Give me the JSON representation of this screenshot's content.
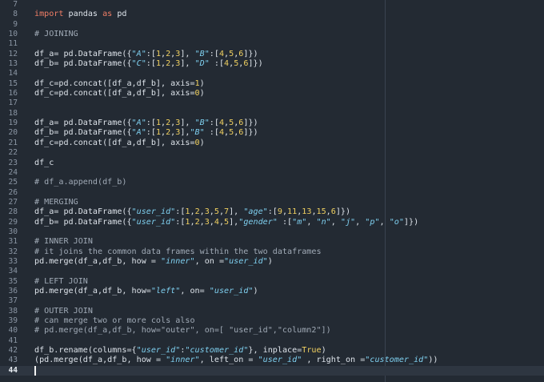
{
  "editor": {
    "current_line": 44,
    "lines": [
      {
        "n": 7,
        "tokens": []
      },
      {
        "n": 8,
        "tokens": [
          {
            "t": "kw",
            "v": "import"
          },
          {
            "t": "id",
            "v": " pandas "
          },
          {
            "t": "kw",
            "v": "as"
          },
          {
            "t": "id",
            "v": " pd"
          }
        ]
      },
      {
        "n": 9,
        "tokens": []
      },
      {
        "n": 10,
        "tokens": [
          {
            "t": "cm",
            "v": "# JOINING"
          }
        ]
      },
      {
        "n": 11,
        "tokens": []
      },
      {
        "n": 12,
        "tokens": [
          {
            "t": "id",
            "v": "df_a"
          },
          {
            "t": "op",
            "v": "= "
          },
          {
            "t": "id",
            "v": "pd.DataFrame({"
          },
          {
            "t": "str",
            "v": "\"A\""
          },
          {
            "t": "op",
            "v": ":["
          },
          {
            "t": "num",
            "v": "1"
          },
          {
            "t": "op",
            "v": ","
          },
          {
            "t": "num",
            "v": "2"
          },
          {
            "t": "op",
            "v": ","
          },
          {
            "t": "num",
            "v": "3"
          },
          {
            "t": "op",
            "v": "], "
          },
          {
            "t": "str",
            "v": "\"B\""
          },
          {
            "t": "op",
            "v": ":["
          },
          {
            "t": "num",
            "v": "4"
          },
          {
            "t": "op",
            "v": ","
          },
          {
            "t": "num",
            "v": "5"
          },
          {
            "t": "op",
            "v": ","
          },
          {
            "t": "num",
            "v": "6"
          },
          {
            "t": "op",
            "v": "]})"
          }
        ]
      },
      {
        "n": 13,
        "tokens": [
          {
            "t": "id",
            "v": "df_b"
          },
          {
            "t": "op",
            "v": "= "
          },
          {
            "t": "id",
            "v": "pd.DataFrame({"
          },
          {
            "t": "str",
            "v": "\"C\""
          },
          {
            "t": "op",
            "v": ":["
          },
          {
            "t": "num",
            "v": "1"
          },
          {
            "t": "op",
            "v": ","
          },
          {
            "t": "num",
            "v": "2"
          },
          {
            "t": "op",
            "v": ","
          },
          {
            "t": "num",
            "v": "3"
          },
          {
            "t": "op",
            "v": "], "
          },
          {
            "t": "str",
            "v": "\"D\""
          },
          {
            "t": "op",
            "v": " :["
          },
          {
            "t": "num",
            "v": "4"
          },
          {
            "t": "op",
            "v": ","
          },
          {
            "t": "num",
            "v": "5"
          },
          {
            "t": "op",
            "v": ","
          },
          {
            "t": "num",
            "v": "6"
          },
          {
            "t": "op",
            "v": "]})"
          }
        ]
      },
      {
        "n": 14,
        "tokens": []
      },
      {
        "n": 15,
        "tokens": [
          {
            "t": "id",
            "v": "df_c"
          },
          {
            "t": "op",
            "v": "="
          },
          {
            "t": "id",
            "v": "pd.concat([df_a,df_b], axis"
          },
          {
            "t": "op",
            "v": "="
          },
          {
            "t": "num",
            "v": "1"
          },
          {
            "t": "op",
            "v": ")"
          }
        ]
      },
      {
        "n": 16,
        "tokens": [
          {
            "t": "id",
            "v": "df_c"
          },
          {
            "t": "op",
            "v": "="
          },
          {
            "t": "id",
            "v": "pd.concat([df_a,df_b], axis"
          },
          {
            "t": "op",
            "v": "="
          },
          {
            "t": "num",
            "v": "0"
          },
          {
            "t": "op",
            "v": ")"
          }
        ]
      },
      {
        "n": 17,
        "tokens": []
      },
      {
        "n": 18,
        "tokens": []
      },
      {
        "n": 19,
        "tokens": [
          {
            "t": "id",
            "v": "df_a"
          },
          {
            "t": "op",
            "v": "= "
          },
          {
            "t": "id",
            "v": "pd.DataFrame({"
          },
          {
            "t": "str",
            "v": "\"A\""
          },
          {
            "t": "op",
            "v": ":["
          },
          {
            "t": "num",
            "v": "1"
          },
          {
            "t": "op",
            "v": ","
          },
          {
            "t": "num",
            "v": "2"
          },
          {
            "t": "op",
            "v": ","
          },
          {
            "t": "num",
            "v": "3"
          },
          {
            "t": "op",
            "v": "], "
          },
          {
            "t": "str",
            "v": "\"B\""
          },
          {
            "t": "op",
            "v": ":["
          },
          {
            "t": "num",
            "v": "4"
          },
          {
            "t": "op",
            "v": ","
          },
          {
            "t": "num",
            "v": "5"
          },
          {
            "t": "op",
            "v": ","
          },
          {
            "t": "num",
            "v": "6"
          },
          {
            "t": "op",
            "v": "]})"
          }
        ]
      },
      {
        "n": 20,
        "tokens": [
          {
            "t": "id",
            "v": "df_b"
          },
          {
            "t": "op",
            "v": "= "
          },
          {
            "t": "id",
            "v": "pd.DataFrame({"
          },
          {
            "t": "str",
            "v": "\"A\""
          },
          {
            "t": "op",
            "v": ":["
          },
          {
            "t": "num",
            "v": "1"
          },
          {
            "t": "op",
            "v": ","
          },
          {
            "t": "num",
            "v": "2"
          },
          {
            "t": "op",
            "v": ","
          },
          {
            "t": "num",
            "v": "3"
          },
          {
            "t": "op",
            "v": "],"
          },
          {
            "t": "str",
            "v": "\"B\""
          },
          {
            "t": "op",
            "v": " :["
          },
          {
            "t": "num",
            "v": "4"
          },
          {
            "t": "op",
            "v": ","
          },
          {
            "t": "num",
            "v": "5"
          },
          {
            "t": "op",
            "v": ","
          },
          {
            "t": "num",
            "v": "6"
          },
          {
            "t": "op",
            "v": "]})"
          }
        ]
      },
      {
        "n": 21,
        "tokens": [
          {
            "t": "id",
            "v": "df_c"
          },
          {
            "t": "op",
            "v": "="
          },
          {
            "t": "id",
            "v": "pd.concat([df_a,df_b], axis"
          },
          {
            "t": "op",
            "v": "="
          },
          {
            "t": "num",
            "v": "0"
          },
          {
            "t": "op",
            "v": ")"
          }
        ]
      },
      {
        "n": 22,
        "tokens": []
      },
      {
        "n": 23,
        "tokens": [
          {
            "t": "id",
            "v": "df_c"
          }
        ]
      },
      {
        "n": 24,
        "tokens": []
      },
      {
        "n": 25,
        "tokens": [
          {
            "t": "cm",
            "v": "# df_a.append(df_b)"
          }
        ]
      },
      {
        "n": 26,
        "tokens": []
      },
      {
        "n": 27,
        "tokens": [
          {
            "t": "cm",
            "v": "# MERGING"
          }
        ]
      },
      {
        "n": 28,
        "tokens": [
          {
            "t": "id",
            "v": "df_a"
          },
          {
            "t": "op",
            "v": "= "
          },
          {
            "t": "id",
            "v": "pd.DataFrame({"
          },
          {
            "t": "str",
            "v": "\"user_id\""
          },
          {
            "t": "op",
            "v": ":["
          },
          {
            "t": "num",
            "v": "1"
          },
          {
            "t": "op",
            "v": ","
          },
          {
            "t": "num",
            "v": "2"
          },
          {
            "t": "op",
            "v": ","
          },
          {
            "t": "num",
            "v": "3"
          },
          {
            "t": "op",
            "v": ","
          },
          {
            "t": "num",
            "v": "5"
          },
          {
            "t": "op",
            "v": ","
          },
          {
            "t": "num",
            "v": "7"
          },
          {
            "t": "op",
            "v": "], "
          },
          {
            "t": "str",
            "v": "\"age\""
          },
          {
            "t": "op",
            "v": ":["
          },
          {
            "t": "num",
            "v": "9"
          },
          {
            "t": "op",
            "v": ","
          },
          {
            "t": "num",
            "v": "11"
          },
          {
            "t": "op",
            "v": ","
          },
          {
            "t": "num",
            "v": "13"
          },
          {
            "t": "op",
            "v": ","
          },
          {
            "t": "num",
            "v": "15"
          },
          {
            "t": "op",
            "v": ","
          },
          {
            "t": "num",
            "v": "6"
          },
          {
            "t": "op",
            "v": "]})"
          }
        ]
      },
      {
        "n": 29,
        "tokens": [
          {
            "t": "id",
            "v": "df_b"
          },
          {
            "t": "op",
            "v": "= "
          },
          {
            "t": "id",
            "v": "pd.DataFrame({"
          },
          {
            "t": "str",
            "v": "\"user_id\""
          },
          {
            "t": "op",
            "v": ":["
          },
          {
            "t": "num",
            "v": "1"
          },
          {
            "t": "op",
            "v": ","
          },
          {
            "t": "num",
            "v": "2"
          },
          {
            "t": "op",
            "v": ","
          },
          {
            "t": "num",
            "v": "3"
          },
          {
            "t": "op",
            "v": ","
          },
          {
            "t": "num",
            "v": "4"
          },
          {
            "t": "op",
            "v": ","
          },
          {
            "t": "num",
            "v": "5"
          },
          {
            "t": "op",
            "v": "],"
          },
          {
            "t": "str",
            "v": "\"gender\""
          },
          {
            "t": "op",
            "v": " :["
          },
          {
            "t": "str",
            "v": "\"m\""
          },
          {
            "t": "op",
            "v": ", "
          },
          {
            "t": "str",
            "v": "\"n\""
          },
          {
            "t": "op",
            "v": ", "
          },
          {
            "t": "str",
            "v": "\"j\""
          },
          {
            "t": "op",
            "v": ", "
          },
          {
            "t": "str",
            "v": "\"p\""
          },
          {
            "t": "op",
            "v": ", "
          },
          {
            "t": "str",
            "v": "\"o\""
          },
          {
            "t": "op",
            "v": "]})"
          }
        ]
      },
      {
        "n": 30,
        "tokens": []
      },
      {
        "n": 31,
        "tokens": [
          {
            "t": "cm",
            "v": "# INNER JOIN"
          }
        ]
      },
      {
        "n": 32,
        "tokens": [
          {
            "t": "cm",
            "v": "# it joins the common data frames within the two dataframes"
          }
        ]
      },
      {
        "n": 33,
        "tokens": [
          {
            "t": "id",
            "v": "pd.merge(df_a,df_b, how "
          },
          {
            "t": "op",
            "v": "= "
          },
          {
            "t": "str",
            "v": "\"inner\""
          },
          {
            "t": "op",
            "v": ", on "
          },
          {
            "t": "op",
            "v": "="
          },
          {
            "t": "str",
            "v": "\"user_id\""
          },
          {
            "t": "op",
            "v": ")"
          }
        ]
      },
      {
        "n": 34,
        "tokens": []
      },
      {
        "n": 35,
        "tokens": [
          {
            "t": "cm",
            "v": "# LEFT JOIN"
          }
        ]
      },
      {
        "n": 36,
        "tokens": [
          {
            "t": "id",
            "v": "pd.merge(df_a,df_b, how"
          },
          {
            "t": "op",
            "v": "="
          },
          {
            "t": "str",
            "v": "\"left\""
          },
          {
            "t": "op",
            "v": ", on"
          },
          {
            "t": "op",
            "v": "= "
          },
          {
            "t": "str",
            "v": "\"user_id\""
          },
          {
            "t": "op",
            "v": ")"
          }
        ]
      },
      {
        "n": 37,
        "tokens": []
      },
      {
        "n": 38,
        "tokens": [
          {
            "t": "cm",
            "v": "# OUTER JOIN"
          }
        ]
      },
      {
        "n": 39,
        "tokens": [
          {
            "t": "cm",
            "v": "# can merge two or more cols also"
          }
        ]
      },
      {
        "n": 40,
        "tokens": [
          {
            "t": "cm",
            "v": "# pd.merge(df_a,df_b, how=\"outer\", on=[ \"user_id\",\"column2\"])"
          }
        ]
      },
      {
        "n": 41,
        "tokens": []
      },
      {
        "n": 42,
        "tokens": [
          {
            "t": "id",
            "v": "df_b.rename(columns"
          },
          {
            "t": "op",
            "v": "={"
          },
          {
            "t": "str",
            "v": "\"user_id\""
          },
          {
            "t": "op",
            "v": ":"
          },
          {
            "t": "str",
            "v": "\"customer_id\""
          },
          {
            "t": "op",
            "v": "}, inplace"
          },
          {
            "t": "op",
            "v": "="
          },
          {
            "t": "num",
            "v": "True"
          },
          {
            "t": "op",
            "v": ")"
          }
        ]
      },
      {
        "n": 43,
        "tokens": [
          {
            "t": "op",
            "v": "(pd.merge(df_a,df_b, how "
          },
          {
            "t": "op",
            "v": "= "
          },
          {
            "t": "str",
            "v": "\"inner\""
          },
          {
            "t": "op",
            "v": ", left_on "
          },
          {
            "t": "op",
            "v": "= "
          },
          {
            "t": "str",
            "v": "\"user_id\""
          },
          {
            "t": "op",
            "v": " , right_on "
          },
          {
            "t": "op",
            "v": "="
          },
          {
            "t": "str",
            "v": "\"customer_id\""
          },
          {
            "t": "op",
            "v": "))"
          }
        ]
      },
      {
        "n": 44,
        "tokens": []
      }
    ]
  },
  "colors": {
    "background": "#232a33",
    "current_line": "#2e3641",
    "keyword": "#f07e66",
    "comment": "#a0aab6",
    "string": "#7fd0f0",
    "number": "#f0d060",
    "text": "#dde3ea",
    "gutter_text": "#8a95a3",
    "ruler": "#3a4350"
  }
}
